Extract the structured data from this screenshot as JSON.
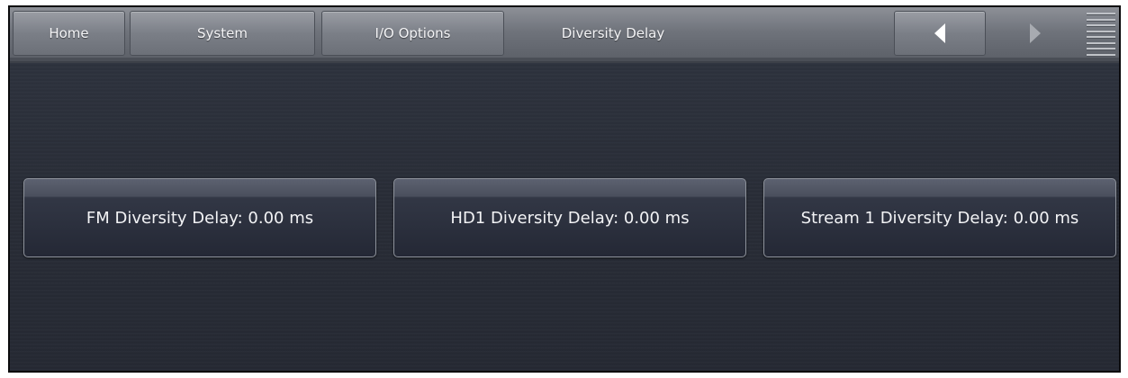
{
  "nav": {
    "home_label": "Home",
    "system_label": "System",
    "io_label": "I/O Options",
    "page_title": "Diversity Delay"
  },
  "delays": {
    "fm_label": "FM Diversity Delay: 0.00 ms",
    "hd1_label": "HD1 Diversity Delay: 0.00 ms",
    "stream1_label": "Stream 1 Diversity Delay: 0.00 ms"
  },
  "icons": {
    "prev": "triangle-left-icon",
    "next": "triangle-right-icon",
    "menu": "menu-grip-icon"
  },
  "colors": {
    "background": "#2a2f3a",
    "navbar": "#6f737b",
    "button_border": "#8e939c",
    "text": "#f2f3f5"
  }
}
